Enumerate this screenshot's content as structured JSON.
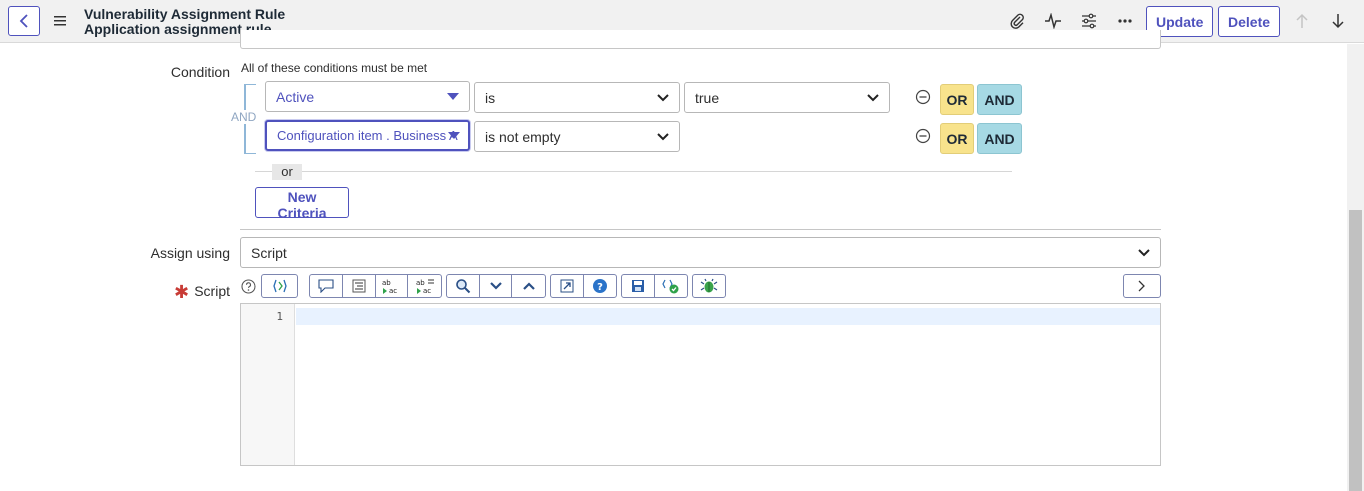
{
  "header": {
    "title_line1": "Vulnerability Assignment Rule",
    "title_line2": "Application assignment rule",
    "update_label": "Update",
    "delete_label": "Delete"
  },
  "condition": {
    "label": "Condition",
    "hint": "All of these conditions must be met",
    "group_operator": "AND",
    "rows": [
      {
        "field": "Active",
        "operator": "is",
        "value": "true"
      },
      {
        "field": "Configuration item . Business A...",
        "operator": "is not empty"
      }
    ],
    "or_label": "OR",
    "and_label": "AND",
    "or_separator": "or",
    "new_criteria_label": "New Criteria"
  },
  "assign_using": {
    "label": "Assign using",
    "value": "Script"
  },
  "script": {
    "label": "Script",
    "required": true,
    "line_numbers": [
      "1"
    ]
  },
  "colors": {
    "accent": "#4f52bd",
    "or_button": "#f8e38c",
    "and_button": "#a6d9e4",
    "required": "#c83c36"
  },
  "icons": {
    "toolbar": [
      "toggle-syntax-icon",
      "comment-icon",
      "format-icon",
      "replace-icon",
      "replace-all-icon",
      "search-icon",
      "chevron-down-icon",
      "chevron-up-icon",
      "fullscreen-icon",
      "help-icon",
      "save-icon",
      "check-syntax-icon",
      "debug-icon",
      "expand-right-icon"
    ]
  }
}
